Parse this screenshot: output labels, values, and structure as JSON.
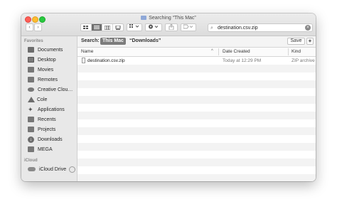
{
  "window": {
    "title": "Searching “This Mac”",
    "back_icon": "‹",
    "forward_icon": "›"
  },
  "toolbar": {
    "view_modes": [
      "icon-view-icon",
      "list-view-icon",
      "column-view-icon",
      "gallery-view-icon"
    ],
    "selected_view": "list-view-icon"
  },
  "search": {
    "value": "destination.csv.zip",
    "search_icon": "⌕",
    "clear_icon": "×"
  },
  "sidebar": {
    "favorites_heading": "Favorites",
    "favorites": [
      {
        "label": "Documents",
        "icon": "documents-icon"
      },
      {
        "label": "Desktop",
        "icon": "desktop-icon"
      },
      {
        "label": "Movies",
        "icon": "movies-icon"
      },
      {
        "label": "Remotes",
        "icon": "remotes-icon"
      },
      {
        "label": "Creative Clou…",
        "icon": "creative-cloud-icon"
      },
      {
        "label": "Cole",
        "icon": "home-icon"
      },
      {
        "label": "Applications",
        "icon": "applications-icon"
      },
      {
        "label": "Recents",
        "icon": "recents-icon"
      },
      {
        "label": "Projects",
        "icon": "folder-icon"
      },
      {
        "label": "Downloads",
        "icon": "downloads-icon"
      },
      {
        "label": "MEGA",
        "icon": "folder-icon"
      }
    ],
    "icloud_heading": "iCloud",
    "icloud": [
      {
        "label": "iCloud Drive",
        "icon": "icloud-icon"
      }
    ]
  },
  "scope": {
    "label": "Search:",
    "selected": "This Mac",
    "other": "“Downloads”",
    "save_label": "Save",
    "add_label": "+"
  },
  "columns": {
    "name": "Name",
    "sort_indicator": "^",
    "date_created": "Date Created",
    "kind": "Kind"
  },
  "results": [
    {
      "name": "destination.csv.zip",
      "date_created": "Today at 12:29 PM",
      "kind": "ZIP archive"
    }
  ]
}
